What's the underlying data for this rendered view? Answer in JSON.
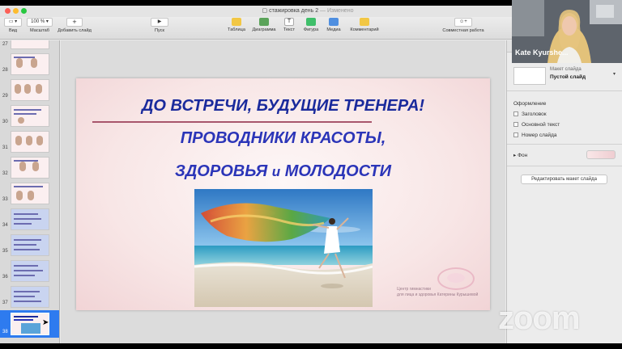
{
  "window": {
    "title": "стажировка день 2",
    "title_status": "Изменено"
  },
  "toolbar": {
    "view": {
      "label": "Вид"
    },
    "zoom": {
      "value": "100 %",
      "label": "Масштаб"
    },
    "add_slide": {
      "label": "Добавить слайд"
    },
    "play": {
      "label": "Пуск"
    },
    "table": {
      "label": "Таблица"
    },
    "chart": {
      "label": "Диаграмма"
    },
    "text": {
      "label": "Текст"
    },
    "shape": {
      "label": "Фигура"
    },
    "media": {
      "label": "Медиа"
    },
    "comment": {
      "label": "Комментарий"
    },
    "collaborate": {
      "label": "Совместная работа"
    }
  },
  "sidebar": {
    "slides": [
      {
        "number": "27"
      },
      {
        "number": "28"
      },
      {
        "number": "29"
      },
      {
        "number": "30"
      },
      {
        "number": "31"
      },
      {
        "number": "32"
      },
      {
        "number": "33"
      },
      {
        "number": "34"
      },
      {
        "number": "35"
      },
      {
        "number": "36"
      },
      {
        "number": "37"
      },
      {
        "number": "38"
      }
    ],
    "selected": "38"
  },
  "slide": {
    "line1": "ДО ВСТРЕЧИ, БУДУЩИЕ ТРЕНЕРА!",
    "line2": "ПРОВОДНИКИ КРАСОТЫ,",
    "line3_a": "ЗДОРОВЬЯ",
    "line3_b": "и",
    "line3_c": "МОЛОДОСТИ",
    "caption_1": "Центр гимнастики",
    "caption_2": "для лица и здоровья Катерины Курышевой"
  },
  "panel": {
    "layout_label": "Макет слайда",
    "layout_value": "Пустой слайд",
    "appearance_title": "Оформление",
    "options": [
      {
        "label": "Заголовок"
      },
      {
        "label": "Основной текст"
      },
      {
        "label": "Номер слайда"
      }
    ],
    "background_label": "Фон",
    "edit_layout_button": "Редактировать макет слайда"
  },
  "video": {
    "participant_name": "Kate Kyurshe..."
  },
  "overlay": {
    "brand": "zoom"
  },
  "colors": {
    "slide_title": "#1a2a9c",
    "selection": "#2e7bef",
    "accent_rule": "#a8566c"
  }
}
